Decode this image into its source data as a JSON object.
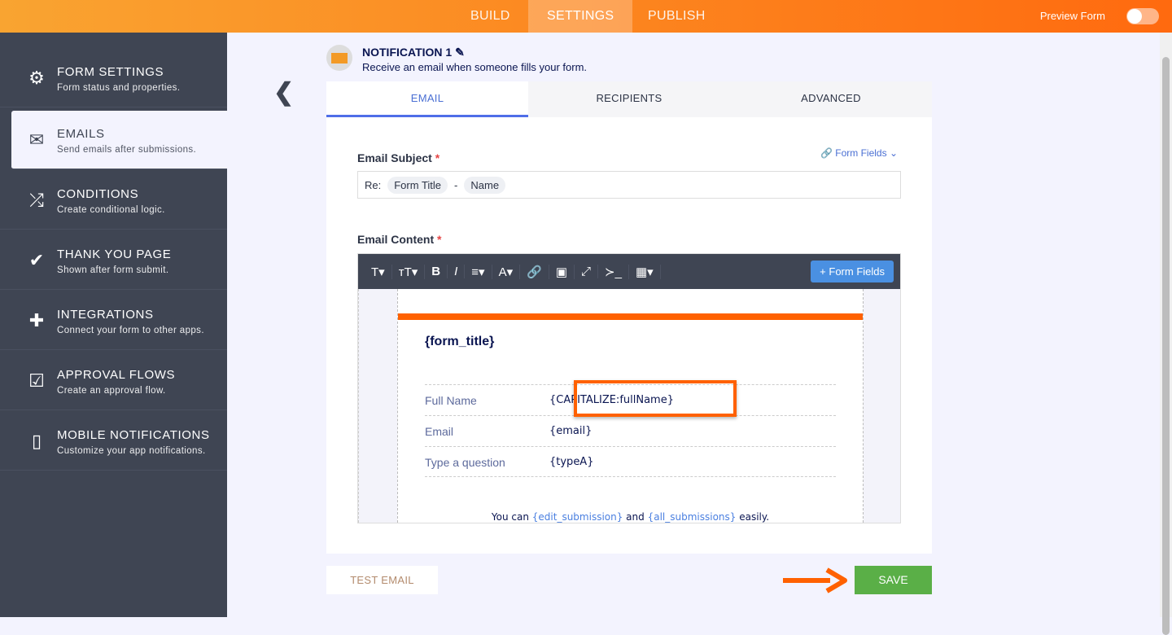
{
  "topbar": {
    "tabs": [
      "BUILD",
      "SETTINGS",
      "PUBLISH"
    ],
    "active": "SETTINGS",
    "preview_label": "Preview Form",
    "preview_on": false,
    "accent": "#ff6100"
  },
  "sidebar": {
    "items": [
      {
        "title": "FORM SETTINGS",
        "desc": "Form status and properties.",
        "icon": "gear-icon"
      },
      {
        "title": "EMAILS",
        "desc": "Send emails after submissions.",
        "icon": "envelope-icon"
      },
      {
        "title": "CONDITIONS",
        "desc": "Create conditional logic.",
        "icon": "shuffle-icon"
      },
      {
        "title": "THANK YOU PAGE",
        "desc": "Shown after form submit.",
        "icon": "check-circle-icon"
      },
      {
        "title": "INTEGRATIONS",
        "desc": "Connect your form to other apps.",
        "icon": "puzzle-icon"
      },
      {
        "title": "APPROVAL FLOWS",
        "desc": "Create an approval flow.",
        "icon": "clipboard-check-icon"
      },
      {
        "title": "MOBILE NOTIFICATIONS",
        "desc": "Customize your app notifications.",
        "icon": "mobile-icon"
      }
    ]
  },
  "notification": {
    "title": "NOTIFICATION 1",
    "subtitle": "Receive an email when someone fills your form."
  },
  "tabs": [
    "EMAIL",
    "RECIPIENTS",
    "ADVANCED"
  ],
  "subject": {
    "label": "Email Subject",
    "required": "*",
    "form_fields": "Form Fields",
    "prefix": "Re:",
    "chip1": "Form Title",
    "sep": "-",
    "chip2": "Name"
  },
  "content": {
    "label": "Email Content",
    "required": "*",
    "form_fields_btn": "+ Form Fields",
    "form_title": "{form_title}",
    "rows": [
      {
        "k": "Full Name",
        "v": "{CAPITALIZE:fullName}"
      },
      {
        "k": "Email",
        "v": "{email}"
      },
      {
        "k": "Type a question",
        "v": "{typeA}"
      }
    ],
    "footer": {
      "a": "You can ",
      "b": "{edit_submission}",
      "c": " and ",
      "d": "{all_submissions}",
      "e": " easily."
    }
  },
  "buttons": {
    "test": "TEST EMAIL",
    "save": "SAVE"
  }
}
